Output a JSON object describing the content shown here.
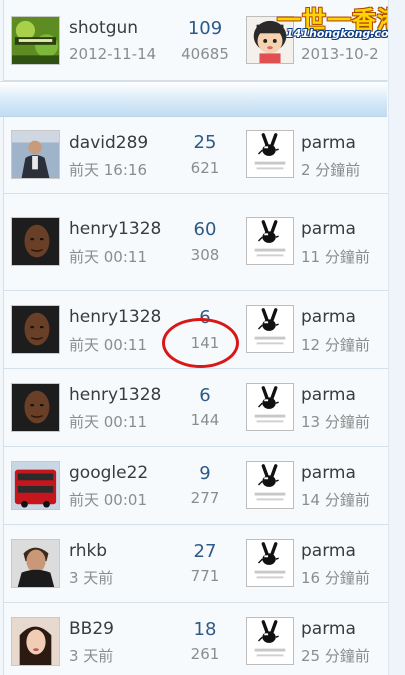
{
  "watermark": {
    "line1": "一世一香港",
    "line2": "141hongkong.com"
  },
  "threads": [
    {
      "author": "shotgun",
      "post_date": "2012-11-14",
      "replies": "109",
      "views": "40685",
      "last_poster": "",
      "last_time": "2013-10-2"
    },
    {
      "author": "david289",
      "post_date": "前天 16:16",
      "replies": "25",
      "views": "621",
      "last_poster": "parma",
      "last_time": "2 分鐘前"
    },
    {
      "author": "henry1328",
      "post_date": "前天 00:11",
      "replies": "60",
      "views": "308",
      "last_poster": "parma",
      "last_time": "11 分鐘前"
    },
    {
      "author": "henry1328",
      "post_date": "前天 00:11",
      "replies": "6",
      "views": "141",
      "last_poster": "parma",
      "last_time": "12 分鐘前"
    },
    {
      "author": "henry1328",
      "post_date": "前天 00:11",
      "replies": "6",
      "views": "144",
      "last_poster": "parma",
      "last_time": "13 分鐘前"
    },
    {
      "author": "google22",
      "post_date": "前天 00:01",
      "replies": "9",
      "views": "277",
      "last_poster": "parma",
      "last_time": "14 分鐘前"
    },
    {
      "author": "rhkb",
      "post_date": "3 天前",
      "replies": "27",
      "views": "771",
      "last_poster": "parma",
      "last_time": "16 分鐘前"
    },
    {
      "author": "BB29",
      "post_date": "3 天前",
      "replies": "18",
      "views": "261",
      "last_poster": "parma",
      "last_time": "25 分鐘前"
    }
  ],
  "colors": {
    "annotation_circle": "#d81818",
    "reply_count": "#2d5a86",
    "separator": "#c2dcf2"
  }
}
